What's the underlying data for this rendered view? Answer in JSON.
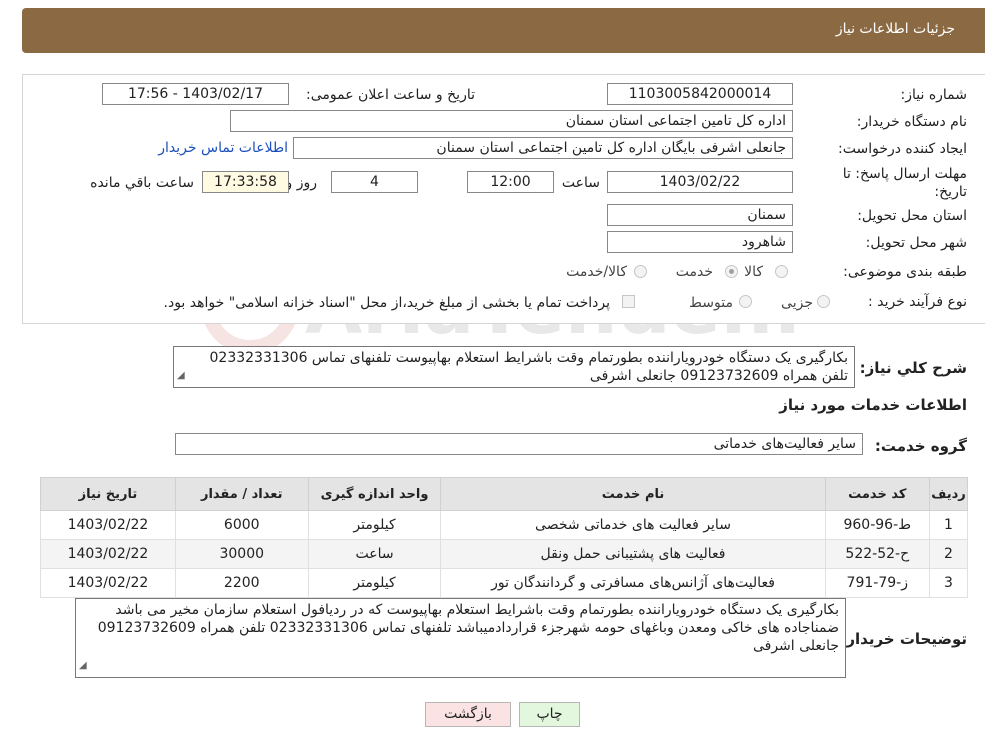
{
  "header": {
    "title": "جزئیات اطلاعات نیاز"
  },
  "form": {
    "need_number_label": "شماره نیاز:",
    "need_number": "1103005842000014",
    "announce_label": "تاریخ و ساعت اعلان عمومی:",
    "announce_value": "1403/02/17 - 17:56",
    "buyer_org_label": "نام دستگاه خريدار:",
    "buyer_org": "اداره کل تامین اجتماعی استان سمنان",
    "creator_label": "ایجاد کننده درخواست:",
    "creator": "جانعلی  اشرفی  بایگان  اداره کل تامین اجتماعی استان سمنان",
    "contact_link": "اطلاعات تماس خریدار",
    "deadline_label": "مهلت ارسال پاسخ: تا تاریخ:",
    "deadline_date": "1403/02/22",
    "time_label": "ساعت",
    "deadline_time": "12:00",
    "days_value": "4",
    "days_label": "روز و",
    "remaining_time": "17:33:58",
    "remaining_label": "ساعت باقي مانده",
    "province_label": "استان محل تحویل:",
    "province": "سمنان",
    "city_label": "شهر محل تحویل:",
    "city": "شاهرود",
    "category_label": "طبقه بندی موضوعی:",
    "category_options": [
      "کالا",
      "خدمت",
      "کالا/خدمت"
    ],
    "category_selected": "خدمت",
    "purchase_type_label": "نوع فرآیند خرید :",
    "purchase_options": [
      "جزیی",
      "متوسط"
    ],
    "payment_note": "پرداخت تمام یا بخشی از مبلغ خرید،از محل \"اسناد خزانه اسلامی\" خواهد بود."
  },
  "summary": {
    "label": "شرح كلي نياز:",
    "text": "بکارگیری یک دستگاه خودرویاراننده بطورتمام وقت باشرایط استعلام بهاپیوست تلفنهای تماس 02332331306 تلفن همراه 09123732609 جانعلی اشرفی"
  },
  "services": {
    "section_title": "اطلاعات خدمات مورد نياز",
    "group_label": "گروه خدمت:",
    "group_value": "سایر فعالیت‌های خدماتی",
    "columns": [
      "ردیف",
      "کد خدمت",
      "نام خدمت",
      "واحد اندازه گیری",
      "تعداد / مقدار",
      "تاریخ نیاز"
    ],
    "rows": [
      [
        "1",
        "ط-96-960",
        "سایر فعالیت های خدماتی شخصی",
        "کیلومتر",
        "6000",
        "1403/02/22"
      ],
      [
        "2",
        "ح-52-522",
        "فعالیت های پشتیبانی حمل ونقل",
        "ساعت",
        "30000",
        "1403/02/22"
      ],
      [
        "3",
        "ز-79-791",
        "فعالیت‌های آژانس‌های مسافرتی و گردانندگان تور",
        "کیلومتر",
        "2200",
        "1403/02/22"
      ]
    ]
  },
  "buyer_notes": {
    "label": "توضیحات خریدار:",
    "text": "بکارگیری یک دستگاه خودرویاراننده بطورتمام وقت باشرایط استعلام بهاپیوست که در ردیافول استعلام سازمان مخیر می باشد ضمناجاده های خاکی ومعدن وباغهای حومه شهرجزء قراردادمیباشد تلفنهای تماس 02332331306 تلفن همراه 09123732609 جانعلی اشرفی"
  },
  "buttons": {
    "print": "چاپ",
    "back": "بازگشت"
  },
  "watermark": {
    "text": "AriaTender.neT"
  },
  "colors": {
    "header_bg": "#8b6a43",
    "link": "#1a4fbd",
    "back_btn_bg": "#fbe3e3",
    "print_btn_bg": "#e3f7df"
  }
}
